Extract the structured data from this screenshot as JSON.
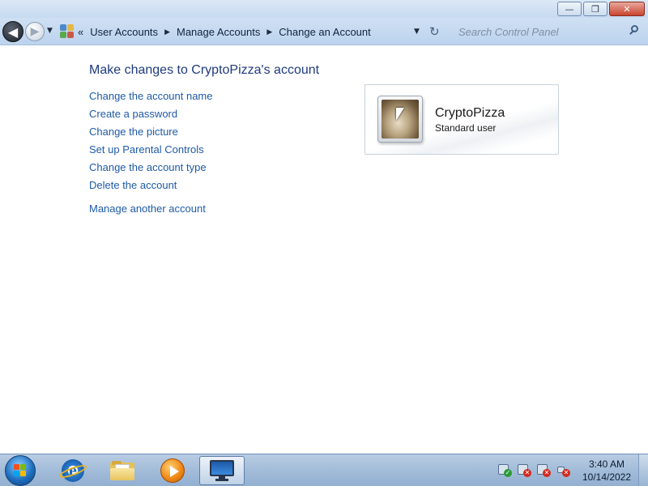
{
  "window": {
    "caption_buttons": {
      "minimize_glyph": "—",
      "maximize_glyph": "❐",
      "close_glyph": "✕"
    }
  },
  "navigation": {
    "back_glyph": "◀",
    "forward_glyph": "▶",
    "recent_glyph": "▼",
    "overflow_glyph": "«",
    "breadcrumbs": [
      "User Accounts",
      "Manage Accounts",
      "Change an Account"
    ],
    "separator_glyph": "▶",
    "dropdown_glyph": "▼",
    "refresh_glyph": "↻",
    "search_placeholder": "Search Control Panel"
  },
  "main": {
    "heading": "Make changes to CryptoPizza's account",
    "tasks": [
      "Change the account name",
      "Create a password",
      "Change the picture",
      "Set up Parental Controls",
      "Change the account type",
      "Delete the account"
    ],
    "other_task": "Manage another account",
    "account": {
      "name": "CryptoPizza",
      "type": "Standard user"
    }
  },
  "taskbar": {
    "pinned": [
      {
        "name": "internet-explorer",
        "icon": "ie-icon"
      },
      {
        "name": "windows-explorer",
        "icon": "folder-icon"
      },
      {
        "name": "windows-media-player",
        "icon": "media-player-icon"
      },
      {
        "name": "control-panel",
        "icon": "monitor-icon",
        "active": true
      }
    ],
    "tray": [
      {
        "icon": "action-center-icon",
        "status": "ok"
      },
      {
        "icon": "network-icon",
        "status": "error"
      },
      {
        "icon": "network-adapter-icon",
        "status": "error"
      },
      {
        "icon": "volume-icon",
        "status": "muted"
      }
    ],
    "clock": {
      "time": "3:40 AM",
      "date": "10/14/2022"
    }
  }
}
